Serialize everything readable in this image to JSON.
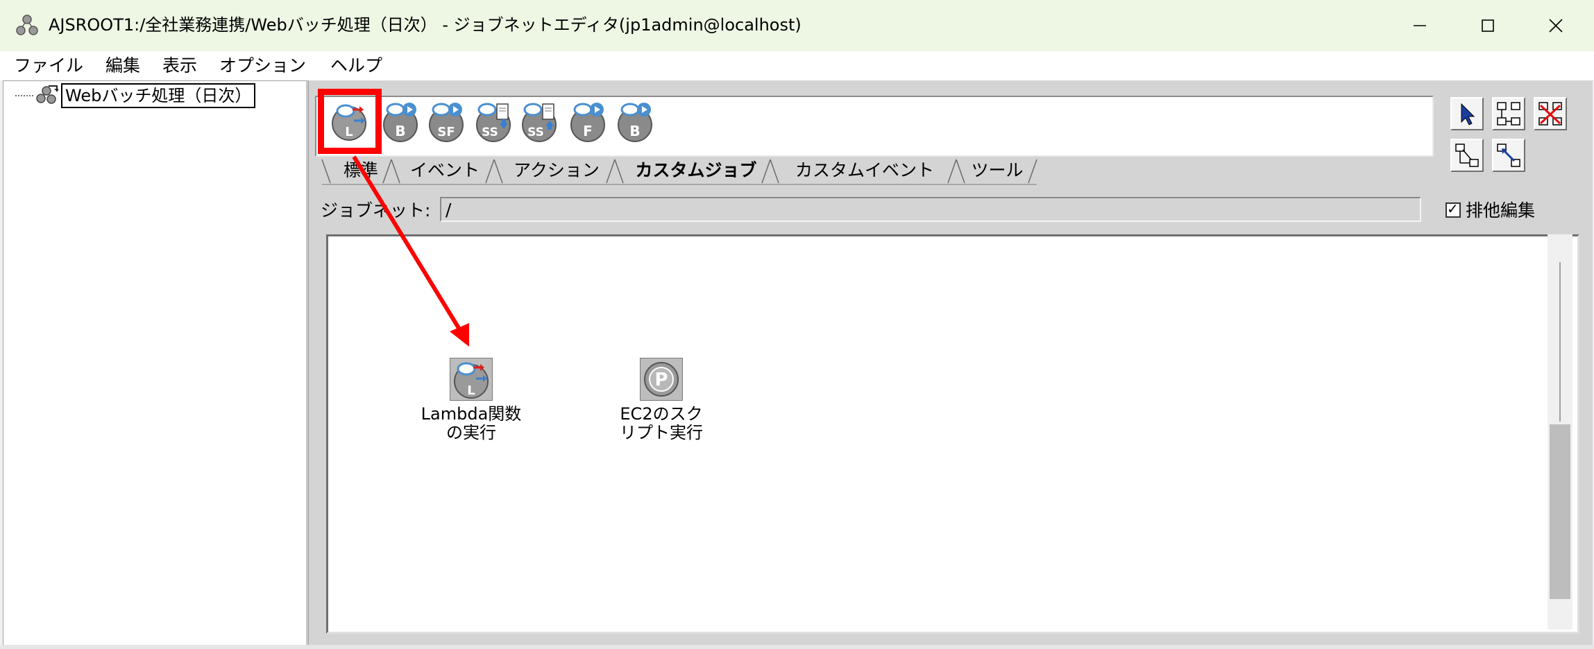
{
  "window": {
    "title": "AJSROOT1:/全社業務連携/Webバッチ処理（日次） - ジョブネットエディタ(jp1admin@localhost)",
    "controls": {
      "minimize": "—",
      "maximize": "☐",
      "close": "✕"
    }
  },
  "menu": {
    "items": [
      "ファイル",
      "編集",
      "表示",
      "オプション",
      "ヘルプ"
    ]
  },
  "tree": {
    "root_label": "Webバッチ処理（日次）"
  },
  "palette": {
    "icons": [
      {
        "name": "lambda-job-icon",
        "letter": "L"
      },
      {
        "name": "batch-job-icon",
        "letter": "B"
      },
      {
        "name": "stepfunctions-job-icon",
        "letter": "SF"
      },
      {
        "name": "s3-download-job-icon",
        "letter": "SS"
      },
      {
        "name": "s3-upload-job-icon",
        "letter": "SS"
      },
      {
        "name": "function-job-icon",
        "letter": "F"
      },
      {
        "name": "blob-job-icon",
        "letter": "B"
      }
    ]
  },
  "tabs": [
    "標準",
    "イベント",
    "アクション",
    "カスタムジョブ",
    "カスタムイベント",
    "ツール"
  ],
  "active_tab": "カスタムジョブ",
  "jobnet": {
    "label": "ジョブネット:",
    "path": "/"
  },
  "exclusive_edit": {
    "label": "排他編集",
    "checked_mark": "✓"
  },
  "canvas": {
    "jobs": [
      {
        "icon_letter": "L",
        "label_line1": "Lambda関数",
        "label_line2": "の実行"
      },
      {
        "icon_letter": "P",
        "label_line1": "EC2のスク",
        "label_line2": "リプト実行"
      }
    ]
  },
  "colors": {
    "highlight": "#ff0000",
    "cloud_blue": "#4a8fd0",
    "icon_gray": "#8a8a8a"
  }
}
